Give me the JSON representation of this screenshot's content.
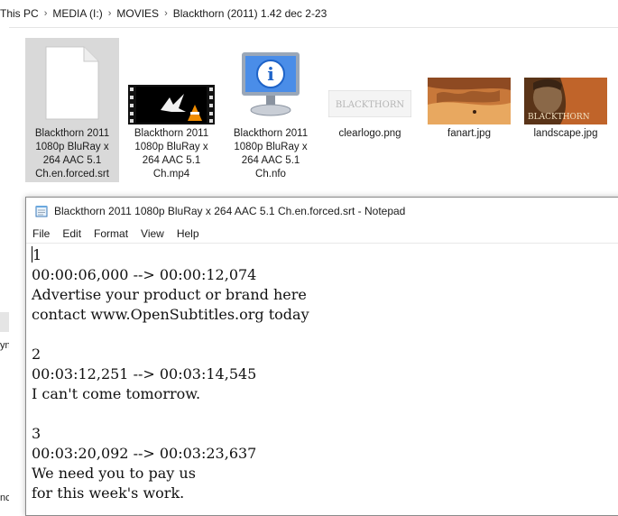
{
  "breadcrumb": [
    "This PC",
    "MEDIA (I:)",
    "MOVIES",
    "Blackthorn (2011) 1.42 dec 2-23"
  ],
  "left_pane": {
    "cut_1": "yn",
    "cut_2": "nc"
  },
  "files": [
    {
      "name_lines": [
        "Blackthorn 2011",
        "1080p BluRay x",
        "264 AAC 5.1",
        "Ch.en.forced.srt"
      ],
      "icon": "document-icon",
      "selected": true
    },
    {
      "name_lines": [
        "Blackthorn 2011",
        "1080p BluRay x",
        "264 AAC 5.1",
        "Ch.mp4"
      ],
      "icon": "video-thumbnail"
    },
    {
      "name_lines": [
        "Blackthorn 2011",
        "1080p BluRay x",
        "264 AAC 5.1",
        "Ch.nfo"
      ],
      "icon": "info-monitor-icon"
    },
    {
      "name_lines": [
        "clearlogo.png"
      ],
      "icon": "clearlogo-thumbnail",
      "logo_text": "BLACKTHORN"
    },
    {
      "name_lines": [
        "fanart.jpg"
      ],
      "icon": "fanart-thumbnail"
    },
    {
      "name_lines": [
        "landscape.jpg"
      ],
      "icon": "landscape-thumbnail",
      "logo_text": "BLACKTHORN"
    }
  ],
  "notepad": {
    "title": "Blackthorn 2011 1080p BluRay x 264 AAC 5.1 Ch.en.forced.srt - Notepad",
    "menu": [
      "File",
      "Edit",
      "Format",
      "View",
      "Help"
    ],
    "lines": [
      "1",
      "00:00:06,000 --> 00:00:12,074",
      "Advertise your product or brand here",
      "contact www.OpenSubtitles.org today",
      "",
      "2",
      "00:03:12,251 --> 00:03:14,545",
      "I can't come tomorrow.",
      "",
      "3",
      "00:03:20,092 --> 00:03:23,637",
      "We need you to pay us",
      "for this week's work."
    ]
  },
  "colors": {
    "selection": "#d9d9d9",
    "vlc_orange": "#f08c00",
    "info_blue": "#1e63c8"
  }
}
